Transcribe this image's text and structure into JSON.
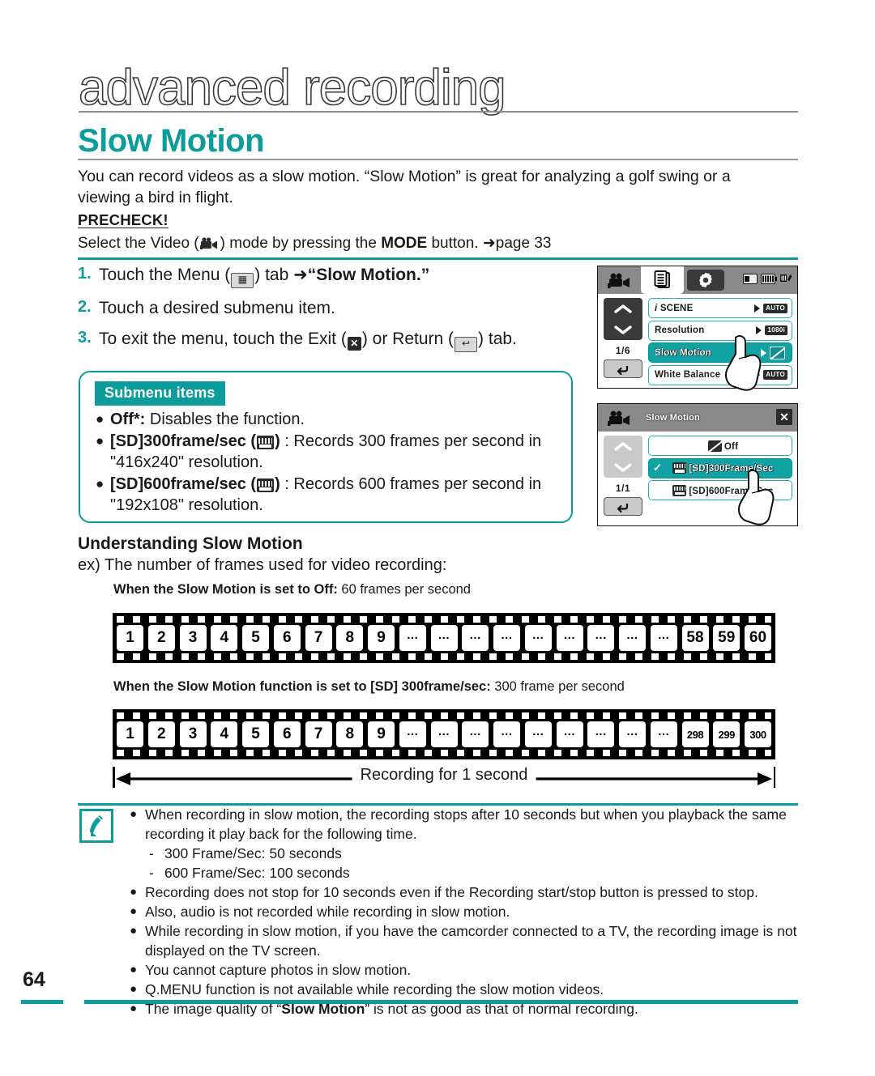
{
  "header": {
    "chapter": "advanced recording",
    "section": "Slow Motion"
  },
  "intro": {
    "paragraph": "You can record videos as a slow motion. “Slow Motion” is great for analyzing a golf swing or a viewing a bird in flight.",
    "precheck_label": "PRECHECK!",
    "precheck_prefix": "Select the Video (",
    "precheck_mid": ") mode by pressing the ",
    "precheck_mode": "MODE",
    "precheck_suffix": " button. ➜",
    "precheck_page": "page 33"
  },
  "steps": [
    {
      "num": "1.",
      "pre": "Touch the Menu (",
      "post": ") tab ➜",
      "bold": "“Slow Motion.”"
    },
    {
      "num": "2.",
      "pre": "Touch a desired submenu item.",
      "post": "",
      "bold": ""
    },
    {
      "num": "3.",
      "pre": "To exit the menu, touch the Exit (",
      "mid": ") or Return (",
      "post": ") tab.",
      "bold": ""
    }
  ],
  "submenu": {
    "tag": "Submenu items",
    "items": [
      {
        "bold": "Off*:",
        "rest": " Disables the function."
      },
      {
        "bold": "[SD]300frame/sec",
        "icon": "film-300-icon",
        "rest": " : Records 300 frames per second in \"416x240\" resolution."
      },
      {
        "bold": "[SD]600frame/sec",
        "icon": "film-600-icon",
        "rest": " : Records 600 frames per second in \"192x108\" resolution."
      }
    ]
  },
  "lcd_menu": {
    "tabs": [
      "camcorder-icon",
      "pages-icon",
      "gear-icon"
    ],
    "status": [
      "card-icon",
      "battery-icon",
      "signal-icon"
    ],
    "page_indicator": "1/6",
    "rows": [
      {
        "label": "SCENE",
        "prefix": "i",
        "badge": "AUTO",
        "highlight": false
      },
      {
        "label": "Resolution",
        "badge": "1080i",
        "highlight": false
      },
      {
        "label": "Slow Motion",
        "badge": "slowmo-off-icon",
        "highlight": true
      },
      {
        "label": "White Balance",
        "badge": "AUTO",
        "highlight": false
      }
    ]
  },
  "lcd_submenu": {
    "title": "Slow Motion",
    "close": "✕",
    "page_indicator": "1/1",
    "rows": [
      {
        "label": "Off",
        "icon": "slowmo-off-icon",
        "selected": false
      },
      {
        "label": "[SD]300Frame/Sec",
        "icon": "film-icon",
        "selected": true
      },
      {
        "label": "[SD]600Frame/Sec",
        "icon": "film-icon",
        "selected": false
      }
    ]
  },
  "understanding": {
    "title": "Understanding Slow Motion",
    "ex": "ex) The number of frames used for video recording:",
    "caption1_bold": "When the Slow Motion is set to Off:",
    "caption1_rest": " 60 frames per second",
    "caption2_bold": "When the Slow Motion function is set to [SD] 300frame/sec:",
    "caption2_rest": " 300 frame per second",
    "arrow_label": "Recording for 1 second"
  },
  "chart_data": {
    "type": "table",
    "title": "Understanding Slow Motion — frames used for video recording",
    "series": [
      {
        "name": "Slow Motion Off",
        "fps": 60,
        "frames": [
          "1",
          "2",
          "3",
          "4",
          "5",
          "6",
          "7",
          "8",
          "9",
          "...",
          "...",
          "...",
          "...",
          "...",
          "...",
          "...",
          "...",
          "...",
          "58",
          "59",
          "60"
        ]
      },
      {
        "name": "[SD] 300frame/sec",
        "fps": 300,
        "frames": [
          "1",
          "2",
          "3",
          "4",
          "5",
          "6",
          "7",
          "8",
          "9",
          "...",
          "...",
          "...",
          "...",
          "...",
          "...",
          "...",
          "...",
          "...",
          "298",
          "299",
          "300"
        ]
      }
    ]
  },
  "notes": [
    {
      "type": "bullet",
      "text": "When recording in slow motion, the recording stops after 10 seconds but when you playback the same recording it play back for the following time."
    },
    {
      "type": "sub",
      "text": "300 Frame/Sec: 50 seconds"
    },
    {
      "type": "sub",
      "text": "600 Frame/Sec: 100 seconds"
    },
    {
      "type": "bullet",
      "text": "Recording does not stop for 10 seconds even if the Recording start/stop button is pressed to stop."
    },
    {
      "type": "bullet",
      "text": "Also, audio is not recorded while recording in slow motion."
    },
    {
      "type": "bullet",
      "text": "While recording in slow motion, if you have the camcorder connected to a TV, the recording image is not displayed on the TV screen."
    },
    {
      "type": "bullet",
      "text": "You cannot capture photos in slow motion."
    },
    {
      "type": "bullet",
      "text": "Q.MENU function is not available while recording the slow motion videos."
    },
    {
      "type": "bullet_rich",
      "pre": "The image quality of “",
      "bold": "Slow Motion",
      "post": "” is not as good as that of normal recording."
    }
  ],
  "footer": {
    "page_number": "64"
  },
  "colors": {
    "accent": "#0d9c9c",
    "highlight": "#11a3a3",
    "dark": "#2b2b2b"
  }
}
